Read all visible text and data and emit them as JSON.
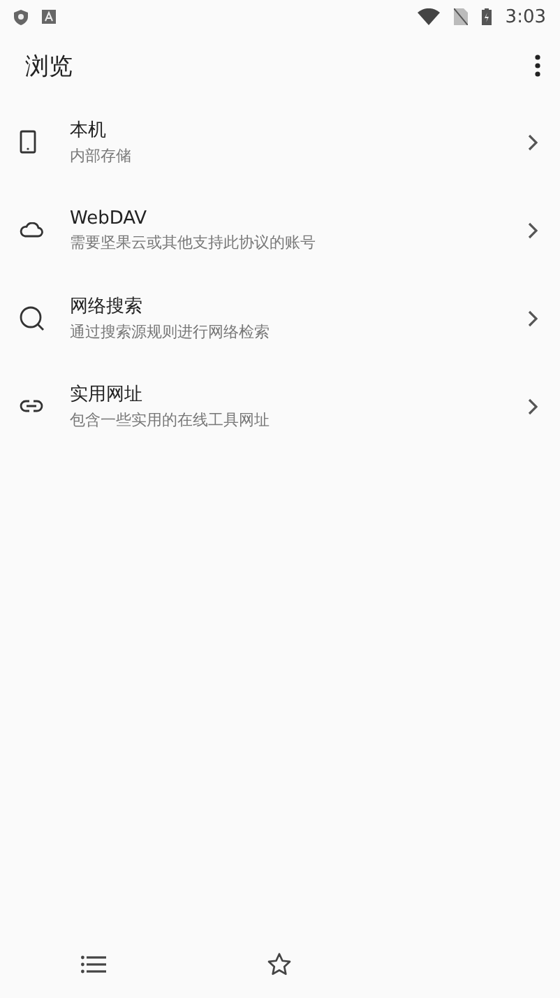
{
  "status_bar": {
    "time": "3:03"
  },
  "toolbar": {
    "title": "浏览"
  },
  "items": [
    {
      "kind": "phone",
      "title": "本机",
      "subtitle": "内部存储"
    },
    {
      "kind": "cloud",
      "title": "WebDAV",
      "subtitle": "需要坚果云或其他支持此协议的账号"
    },
    {
      "kind": "search",
      "title": "网络搜索",
      "subtitle": "通过搜索源规则进行网络检索"
    },
    {
      "kind": "link",
      "title": "实用网址",
      "subtitle": "包含一些实用的在线工具网址"
    }
  ],
  "bottom_nav": [
    {
      "kind": "list"
    },
    {
      "kind": "star"
    }
  ]
}
